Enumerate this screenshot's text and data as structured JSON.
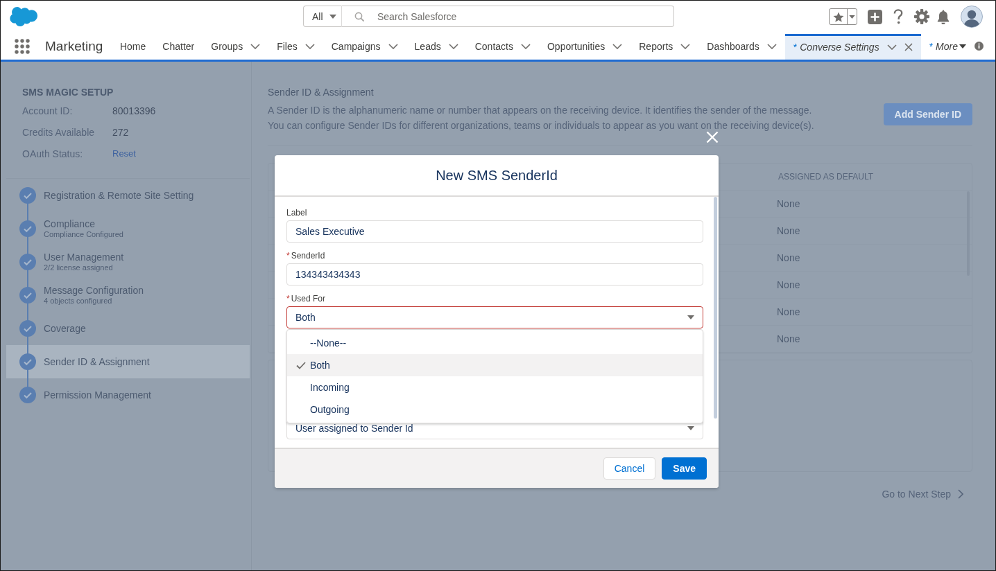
{
  "global_header": {
    "search": {
      "scope": "All",
      "placeholder": "Search Salesforce"
    }
  },
  "nav": {
    "app_name": "Marketing",
    "items": [
      {
        "label": "Home",
        "kind": "object",
        "menu": false,
        "selected": false
      },
      {
        "label": "Chatter",
        "kind": "object",
        "menu": false,
        "selected": false
      },
      {
        "label": "Groups",
        "kind": "object",
        "menu": true,
        "selected": false
      },
      {
        "label": "Files",
        "kind": "object",
        "menu": true,
        "selected": false
      },
      {
        "label": "Campaigns",
        "kind": "object",
        "menu": true,
        "selected": false
      },
      {
        "label": "Leads",
        "kind": "object",
        "menu": true,
        "selected": false
      },
      {
        "label": "Contacts",
        "kind": "object",
        "menu": true,
        "selected": false
      },
      {
        "label": "Opportunities",
        "kind": "object",
        "menu": true,
        "selected": false
      },
      {
        "label": "Reports",
        "kind": "object",
        "menu": true,
        "selected": false
      },
      {
        "label": "Dashboards",
        "kind": "object",
        "menu": true,
        "selected": false
      },
      {
        "label": "Converse Settings",
        "kind": "workspace",
        "unsaved_mark": "*",
        "menu": true,
        "closable": true,
        "selected": true
      },
      {
        "label": "More",
        "kind": "overflow",
        "unsaved_mark": "*",
        "selected": false
      }
    ]
  },
  "setup": {
    "title": "SMS MAGIC SETUP",
    "fields": [
      {
        "label": "Account ID:",
        "value": "80013396",
        "kind": "text"
      },
      {
        "label": "Credits Available",
        "value": "272",
        "kind": "text"
      },
      {
        "label": "OAuth Status:",
        "value": "Reset",
        "kind": "link"
      }
    ],
    "steps": [
      {
        "title": "Registration & Remote Site Setting",
        "completed": true,
        "selected": false
      },
      {
        "title": "Compliance",
        "subtitle": "Compliance Configured",
        "completed": true,
        "selected": false
      },
      {
        "title": "User Management",
        "subtitle": "2/2 license assigned",
        "completed": true,
        "selected": false
      },
      {
        "title": "Message Configuration",
        "subtitle": "4 objects configured",
        "completed": true,
        "selected": false
      },
      {
        "title": "Coverage",
        "completed": true,
        "selected": false
      },
      {
        "title": "Sender ID & Assignment",
        "completed": true,
        "selected": true
      },
      {
        "title": "Permission Management",
        "completed": true,
        "selected": false
      }
    ]
  },
  "content": {
    "title": "Sender ID & Assignment",
    "description": [
      "A Sender ID is the alphanumeric name or number that appears on the receiving device. It identifies the sender of the message.",
      "You can configure Sender IDs for different organizations, teams or individuals to appear as you want on the receiving device(s)."
    ],
    "add_button": "Add Sender ID",
    "table": {
      "columns": [
        {
          "label": "ASSIGNED AS DEFAULT"
        }
      ],
      "rows": [
        [
          "None"
        ],
        [
          "None"
        ],
        [
          "None"
        ],
        [
          "None"
        ],
        [
          "None"
        ],
        [
          "None"
        ]
      ]
    },
    "next_step": "Go to Next Step"
  },
  "modal": {
    "title": "New SMS SenderId",
    "fields": [
      {
        "label": "Label",
        "kind": "text",
        "value": "Sales Executive"
      },
      {
        "label": "SenderId",
        "required_mark": "*",
        "kind": "text",
        "value": "134343434343"
      },
      {
        "label": "Used For",
        "required_mark": "*",
        "kind": "select",
        "value": "Both",
        "invalid": true,
        "expanded": true,
        "options": [
          {
            "label": "--None--",
            "selected": false
          },
          {
            "label": "Both",
            "selected": true
          },
          {
            "label": "Incoming",
            "selected": false
          },
          {
            "label": "Outgoing",
            "selected": false
          }
        ]
      },
      {
        "kind": "select",
        "value": "User assigned to Sender Id"
      }
    ],
    "buttons": [
      {
        "label": "Cancel",
        "kind": "neutral"
      },
      {
        "label": "Save",
        "kind": "brand"
      }
    ]
  }
}
